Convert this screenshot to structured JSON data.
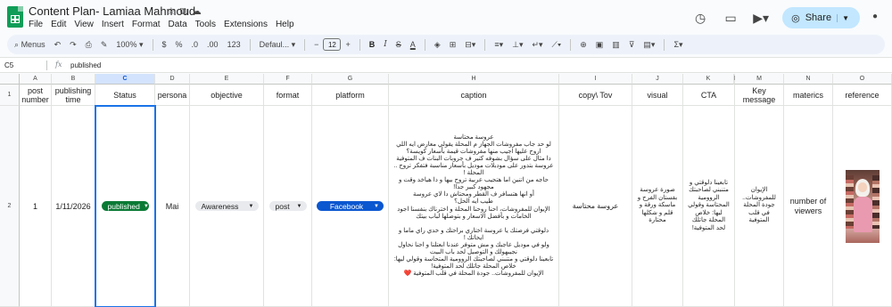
{
  "app": {
    "doc_title": "Content Plan- Lamiaa Mahmoud",
    "title_icons": [
      "star-icon",
      "move-icon",
      "cloud-icon"
    ],
    "menu": [
      "File",
      "Edit",
      "View",
      "Insert",
      "Format",
      "Data",
      "Tools",
      "Extensions",
      "Help"
    ],
    "share_label": "Share"
  },
  "toolbar": {
    "menus_label": "Menus",
    "zoom": "100%",
    "percent": "%",
    "dec_decrease": ".0",
    "dec_increase": ".00",
    "number_format": "123",
    "font_family": "Defaul...",
    "font_size": "12",
    "bold": "B",
    "italic": "I",
    "strike": "S",
    "text_color": "A"
  },
  "formula": {
    "name_box": "C5",
    "fx": "fx",
    "value": "published"
  },
  "columns": [
    "A",
    "B",
    "C",
    "D",
    "E",
    "F",
    "G",
    "H",
    "I",
    "J",
    "K",
    "L",
    "M",
    "N",
    "O"
  ],
  "rows": [
    "1",
    "2"
  ],
  "headers": {
    "post_number": "post number",
    "publishing_time": "publishing time",
    "status": "Status",
    "persona": "persona",
    "objective": "objective",
    "format": "format",
    "platform": "platform",
    "caption": "caption",
    "copy_tov": "copy\\ Tov",
    "visual": "visual",
    "cta": "CTA",
    "key_message": "Key message",
    "materics": "materics",
    "reference": "reference"
  },
  "row1": {
    "post_number": "1",
    "publishing_time": "1/11/2026",
    "status": "published",
    "persona": "Mai",
    "objective": "Awareness",
    "format": "post",
    "platform": "Facebook",
    "caption_lines": [
      "عروسة محتاسة",
      "لو حد جاب مفروشات الجهاز م المحلة يقولي معارض ايه اللي",
      "اروح عليها اجيب منها مفروشات قيمة بأسعار كويسة؟",
      "دا مثال على سؤال بشوفه كتير ف جروبات البنات ف المتوفية",
      "عروسة بتدور على مودبلات موديل بأسعار مناسبة فتفكر تروح ..",
      "المحلة !",
      "حاجه من اتنين اما هتجيب عربية تروح بيها و دا هياخد وقت و",
      "مجهود كبير جدا!",
      "أو انها هتسافر ف القطر ومحتاش دا لاي عروسة",
      "طيب ايه الحل؟",
      "الإيوان للمفروشات، احنا روحنا المحلة و اخترناك بنفسنا اجود",
      "الخامات و بأفضل الاسعار و بتوصلها لباب بيتك",
      "",
      "دلوقتي فرصتك يا عروسة اختاري براحتك و خدي راي ماما و",
      "ايحاتك !",
      "ولو في موديل عاجبك و مش متوفر عندنا ابعتلنا و احنا نحاول",
      "نجيبهولك و التوصيل لحد باب البيت",
      "تابعينا دلوقتي و متنبني لصاحبتك الروومية المتحاسة وقولي ليها:",
      "خلاص المحلة جاتلك لحد المتوفية!",
      "الإيوان للمفروشات.. جودة المحلة في قلب المتوفية ❤️"
    ],
    "copy_tov": "عروسة محتاسة",
    "visual": "صورة عروسة بفستان الفرح و ماسكة ورقة و قلم و شكلها محتارة",
    "cta": "تابعينا دلوقتي و متنبني لصاحبتك الروومية المحتاسة وقولي ليها: خلاص المحلة جاتلك لحد المتوفية!",
    "key_message": "الإيوان للمفروشات.. جودة المحلة في قلب المتوفية",
    "materics": "number of viewers"
  },
  "colors": {
    "status_chip": "#0a7a35",
    "platform_chip": "#0b57d0",
    "objective_chip": "#e8eaed",
    "share_button": "#c2e7ff",
    "logo": "#0f9d58"
  }
}
